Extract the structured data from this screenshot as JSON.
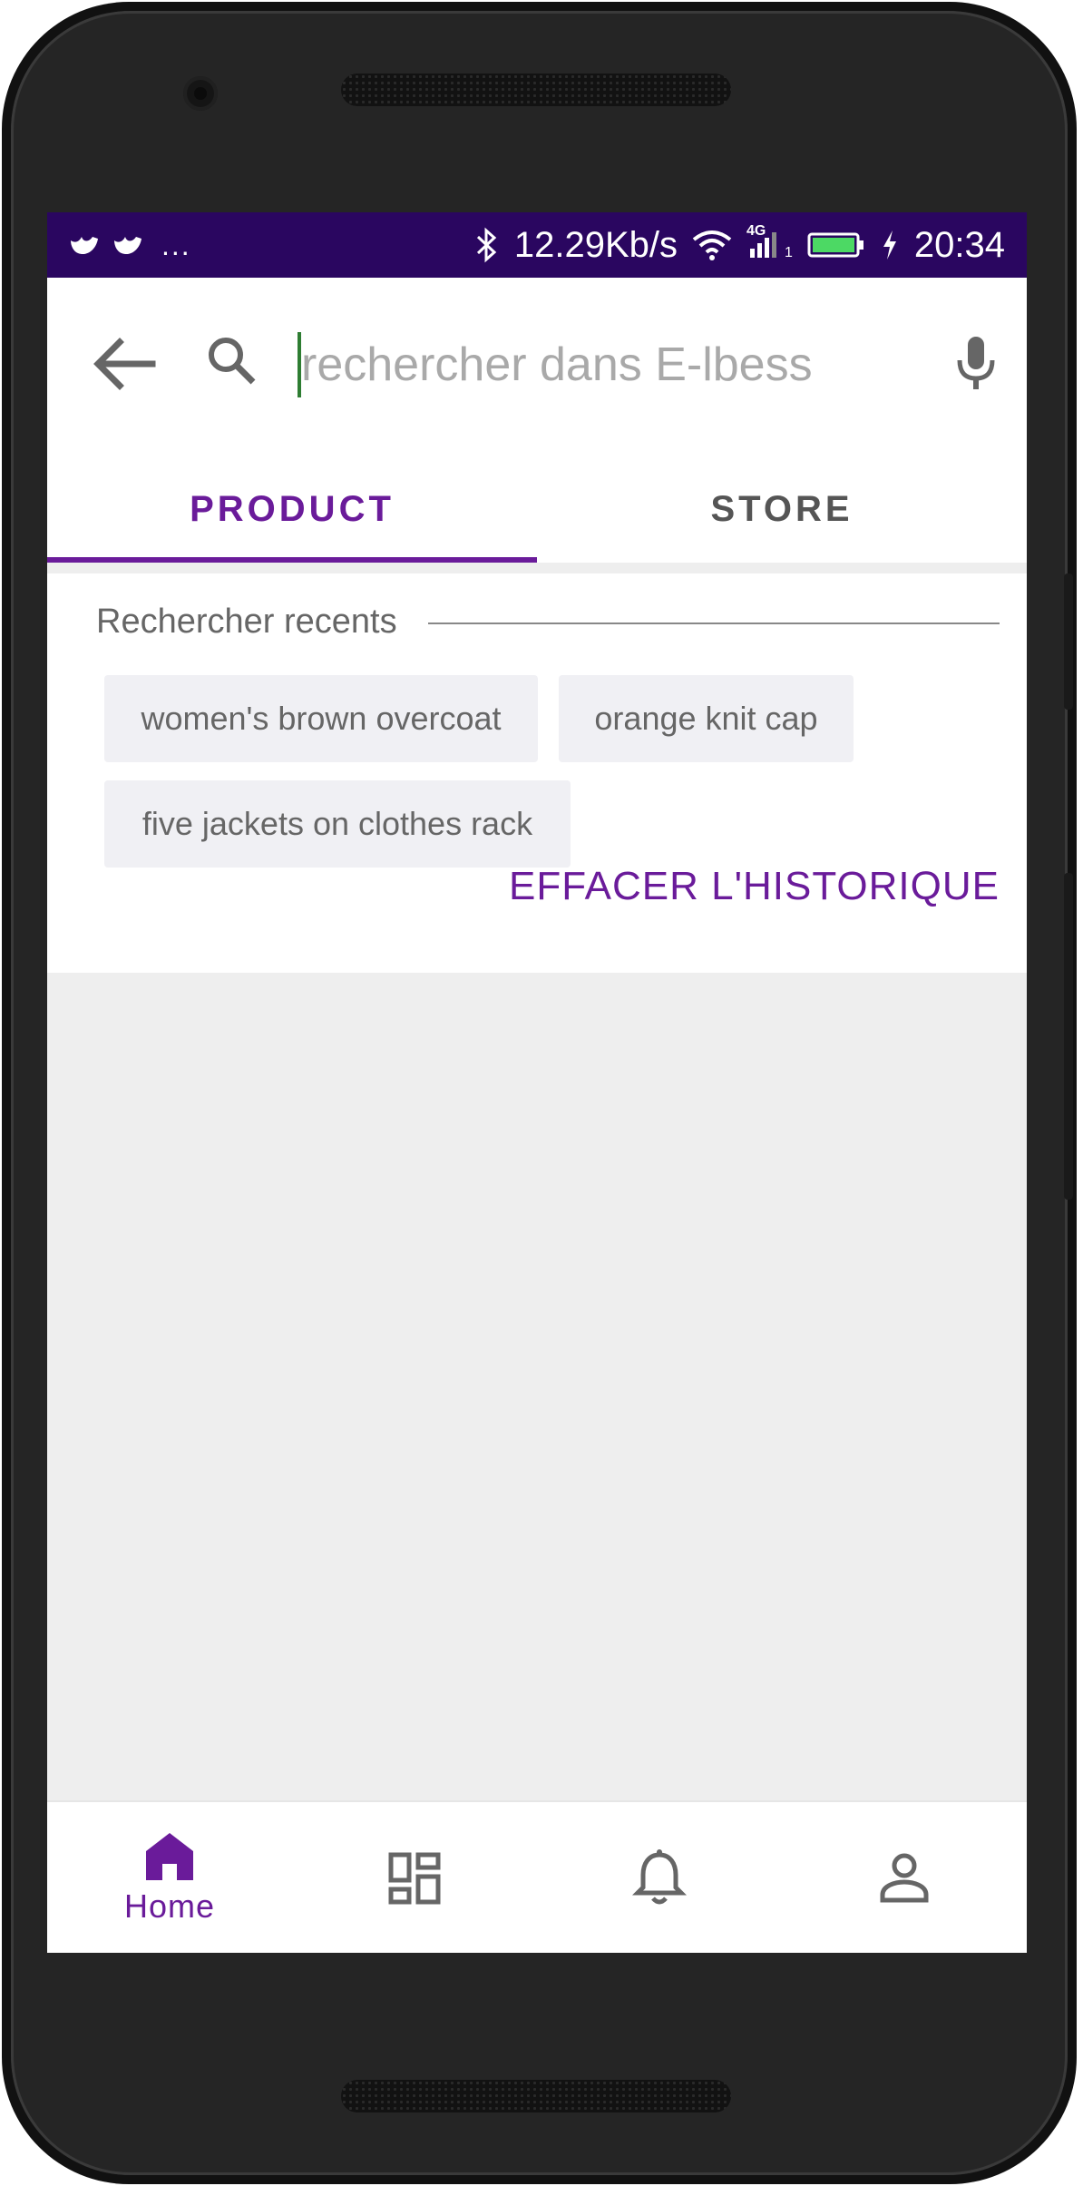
{
  "status_bar": {
    "speed": "12.29Kb/s",
    "time": "20:34",
    "overflow": "...",
    "signal_badge": "4G",
    "sim_slot": "1",
    "icons": [
      "bird-notification-icon",
      "bird-notification-icon",
      "bluetooth-icon",
      "wifi-icon",
      "signal-icon",
      "battery-icon",
      "charging-icon"
    ],
    "bg_color": "#2a0660"
  },
  "search": {
    "placeholder": "rechercher dans E-lbess",
    "value": ""
  },
  "tabs": [
    {
      "label": "PRODUCT",
      "active": true
    },
    {
      "label": "STORE",
      "active": false
    }
  ],
  "recent": {
    "title": "Rechercher recents",
    "items": [
      "women's brown overcoat",
      "orange knit cap",
      "five jackets on clothes rack"
    ],
    "clear_label": "EFFACER L'HISTORIQUE"
  },
  "bottom_nav": {
    "items": [
      {
        "label": "Home",
        "icon": "home-icon",
        "active": true
      },
      {
        "label": "",
        "icon": "dashboard-icon",
        "active": false
      },
      {
        "label": "",
        "icon": "bell-icon",
        "active": false
      },
      {
        "label": "",
        "icon": "person-icon",
        "active": false
      }
    ]
  },
  "colors": {
    "accent": "#6a1b9a",
    "cursor": "#2e7d32",
    "chip_bg": "#f0f0f4",
    "page_bg": "#eeeeee"
  }
}
